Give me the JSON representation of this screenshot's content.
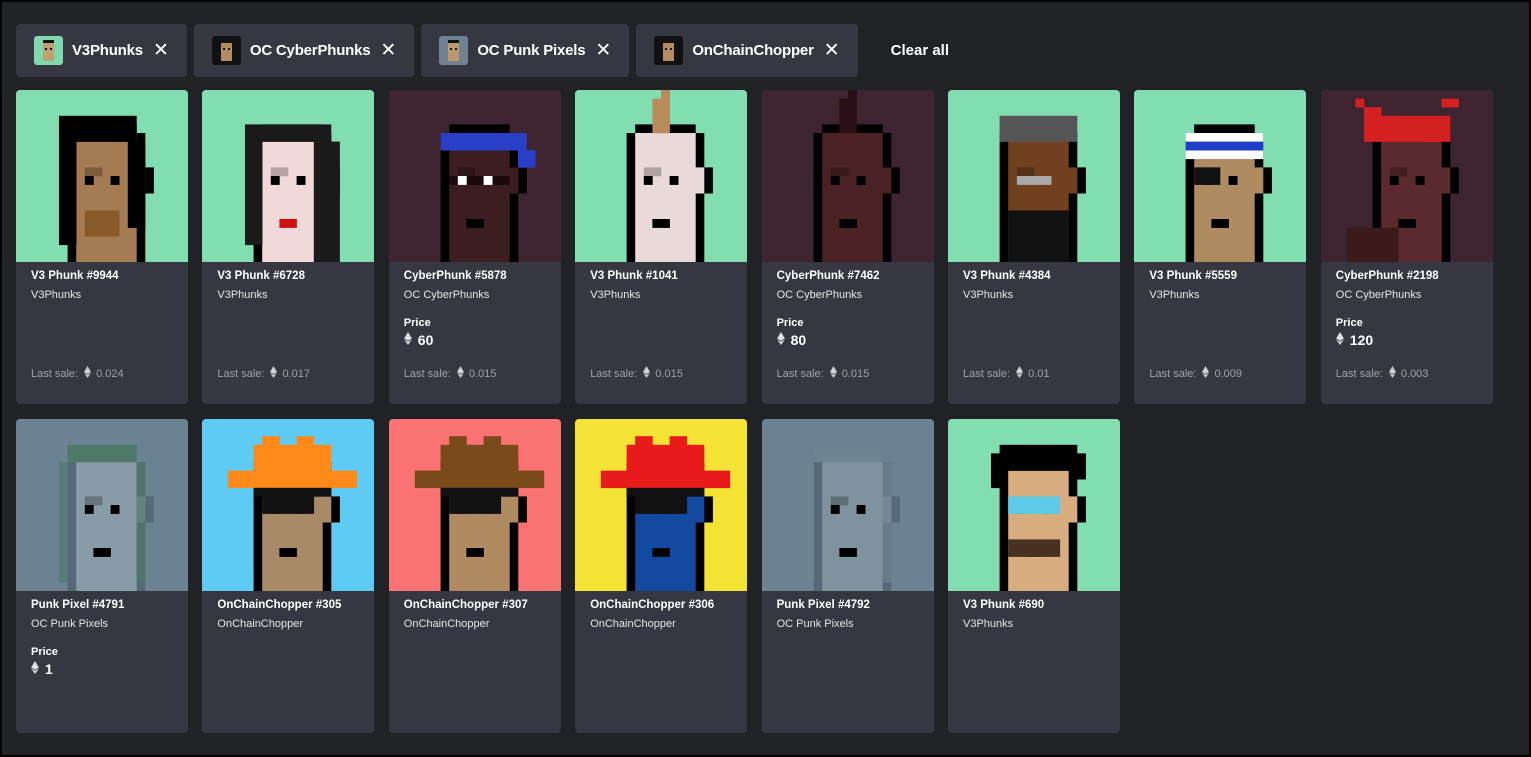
{
  "filters": [
    {
      "label": "V3Phunks",
      "thumb_bg": "#7fd9ac",
      "icon": "phunk-thumb"
    },
    {
      "label": "OC CyberPhunks",
      "thumb_bg": "#111111",
      "icon": "cyberphunk-thumb"
    },
    {
      "label": "OC Punk Pixels",
      "thumb_bg": "#6f8393",
      "icon": "punk-pixel-thumb"
    },
    {
      "label": "OnChainChopper",
      "thumb_bg": "#111111",
      "icon": "chopper-thumb"
    }
  ],
  "clear_all": "Clear all",
  "last_sale_label": "Last sale:",
  "price_label": "Price",
  "cards": [
    {
      "name": "V3 Phunk #9944",
      "collection": "V3Phunks",
      "last_sale": "0.024",
      "bg": "#82deb0",
      "skin": "#a57c52",
      "hair": "#000000",
      "style": "longhair"
    },
    {
      "name": "V3 Phunk #6728",
      "collection": "V3Phunks",
      "last_sale": "0.017",
      "bg": "#82deb0",
      "skin": "#f2d9d9",
      "hair": "#1a1a1a",
      "style": "female"
    },
    {
      "name": "CyberPhunk #5878",
      "collection": "OC CyberPhunks",
      "price": "60",
      "last_sale": "0.015",
      "bg": "#3d2430",
      "skin": "#3d1e20",
      "hair": "#2a3fc8",
      "style": "bandana"
    },
    {
      "name": "V3 Phunk #1041",
      "collection": "V3Phunks",
      "last_sale": "0.015",
      "bg": "#82deb0",
      "skin": "#ead9d9",
      "hair": "#b98a5a",
      "style": "mohawk"
    },
    {
      "name": "CyberPhunk #7462",
      "collection": "OC CyberPhunks",
      "price": "80",
      "last_sale": "0.015",
      "bg": "#3d2430",
      "skin": "#4a2226",
      "hair": "#2a1015",
      "style": "mohawk"
    },
    {
      "name": "V3 Phunk #4384",
      "collection": "V3Phunks",
      "last_sale": "0.01",
      "bg": "#82deb0",
      "skin": "#71411f",
      "hair": "#555555",
      "style": "cap"
    },
    {
      "name": "V3 Phunk #5559",
      "collection": "V3Phunks",
      "last_sale": "0.009",
      "bg": "#82deb0",
      "skin": "#ae8b61",
      "hair": "#ffffff",
      "style": "headband"
    },
    {
      "name": "CyberPhunk #2198",
      "collection": "OC CyberPhunks",
      "price": "120",
      "last_sale": "0.003",
      "bg": "#3d2430",
      "skin": "#5a2a2e",
      "hair": "#d42020",
      "style": "wild"
    },
    {
      "name": "Punk Pixel #4791",
      "collection": "OC Punk Pixels",
      "price": "1",
      "bg": "#6b8293",
      "skin": "#8a9ba8",
      "hair": "#4f7a6a",
      "style": "faded"
    },
    {
      "name": "OnChainChopper #305",
      "collection": "OnChainChopper",
      "bg": "#5ecbf5",
      "skin": "#a88a66",
      "hair": "#ff8a1a",
      "style": "hat"
    },
    {
      "name": "OnChainChopper #307",
      "collection": "OnChainChopper",
      "bg": "#fa7272",
      "skin": "#b08a60",
      "hair": "#7b4a1a",
      "style": "hat"
    },
    {
      "name": "OnChainChopper #306",
      "collection": "OnChainChopper",
      "bg": "#f4e235",
      "skin": "#124aa0",
      "hair": "#e81a1a",
      "style": "hat"
    },
    {
      "name": "Punk Pixel #4792",
      "collection": "OC Punk Pixels",
      "bg": "#6b8293",
      "skin": "#7f929e",
      "hair": "#6f8493",
      "style": "faded"
    },
    {
      "name": "V3 Phunk #690",
      "collection": "V3Phunks",
      "last_sale": "",
      "bg": "#82deb0",
      "skin": "#d7ad80",
      "hair": "#000000",
      "style": "messy"
    }
  ]
}
